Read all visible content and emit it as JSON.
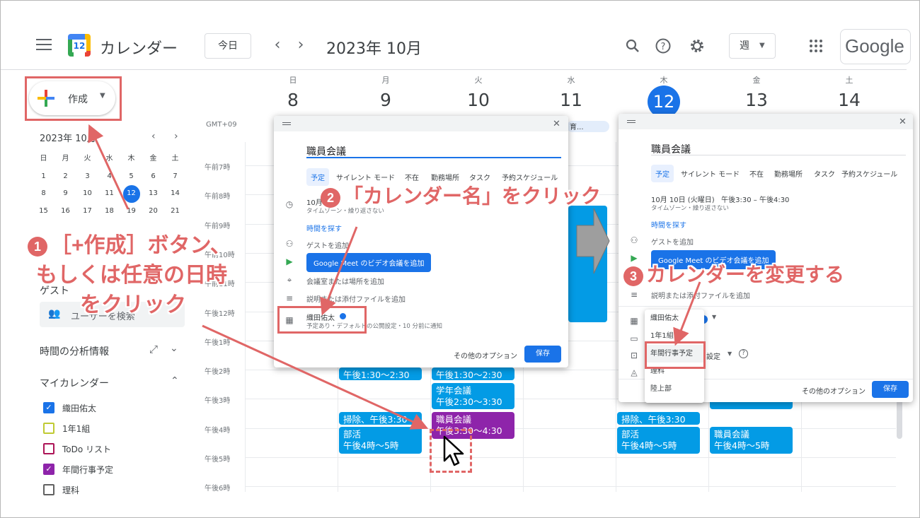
{
  "header": {
    "app_title": "カレンダー",
    "logo_day": "12",
    "today_label": "今日",
    "month_title": "2023年 10月",
    "view_label": "週",
    "google_logo": "Google"
  },
  "sidebar": {
    "create_label": "作成",
    "mini_cal": {
      "title": "2023年 10月",
      "weekdays": [
        "日",
        "月",
        "火",
        "水",
        "木",
        "金",
        "土"
      ],
      "days": [
        "1",
        "2",
        "3",
        "4",
        "5",
        "6",
        "7",
        "8",
        "9",
        "10",
        "11",
        "12",
        "13",
        "14",
        "15",
        "16",
        "17",
        "18",
        "19",
        "20",
        "21"
      ],
      "today": "12"
    },
    "guest_heading": "ゲスト",
    "guest_search_placeholder": "ユーザーを検索",
    "analytics_label": "時間の分析情報",
    "my_calendars_label": "マイカレンダー",
    "calendars": [
      {
        "name": "織田佑太",
        "color": "#1a73e8",
        "checked": true
      },
      {
        "name": "1年1組",
        "color": "#c0ca33",
        "checked": false
      },
      {
        "name": "ToDo リスト",
        "color": "#ad1457",
        "checked": false
      },
      {
        "name": "年間行事予定",
        "color": "#8e24aa",
        "checked": true
      },
      {
        "name": "理科",
        "color": "#616161",
        "checked": false
      }
    ]
  },
  "week": {
    "days": [
      {
        "name": "日",
        "num": "8"
      },
      {
        "name": "月",
        "num": "9"
      },
      {
        "name": "火",
        "num": "10"
      },
      {
        "name": "水",
        "num": "11"
      },
      {
        "name": "木",
        "num": "12"
      },
      {
        "name": "金",
        "num": "13"
      },
      {
        "name": "土",
        "num": "14"
      }
    ],
    "timezone": "GMT+09",
    "times": [
      "午前7時",
      "午前8時",
      "午前9時",
      "午前10時",
      "午前11時",
      "午後12時",
      "午後1時",
      "午後2時",
      "午後3時",
      "午後4時",
      "午後5時",
      "午後6時"
    ],
    "allday_event": "育...",
    "events": {
      "e1": "午後1:30～2:30",
      "e2": "午後1:30～2:30",
      "e3_title": "学年会議",
      "e3_time": "午後2:30～3:30",
      "e4": "掃除、午後3:30",
      "e5_title": "職員会議",
      "e5_time": "午後3:30～4:30",
      "e6_title": "部活",
      "e6_time": "午後4時～5時",
      "e7": "掃除、午後3:30",
      "e8_title": "部活",
      "e8_time": "午後4時～5時",
      "e9_title": "職員会議",
      "e9_time": "午後4時～5時"
    }
  },
  "dialog1": {
    "title_value": "職員会議",
    "tabs": [
      "予定",
      "サイレント モード",
      "不在",
      "勤務場所",
      "タスク",
      "予約スケジュール"
    ],
    "date_text": "10月",
    "tz_text": "タイムゾーン・繰り返さない",
    "find_time": "時間を探す",
    "add_guest": "ゲストを追加",
    "meet_btn": "Google Meet のビデオ会議を追加",
    "add_room": "会議室または場所を追加",
    "add_desc": "説明または添付ファイルを追加",
    "calendar_name": "織田佑太",
    "calendar_sub": "予定あり・デフォルトの公開設定・10 分前に通知",
    "more_options": "その他のオプション",
    "save": "保存"
  },
  "dialog2": {
    "title_value": "職員会議",
    "tabs": [
      "予定",
      "サイレント モード",
      "不在",
      "勤務場所",
      "タスク",
      "予約スケジュール"
    ],
    "date_text": "10月 10日 (火曜日)   午後3:30 – 午後4:30",
    "tz_text": "タイムゾーン・繰り返さない",
    "find_time": "時間を探す",
    "add_guest": "ゲストを追加",
    "meet_btn": "Google Meet のビデオ会議を追加",
    "add_desc": "説明または添付ファイルを追加",
    "visibility_partial": "設定",
    "more_options": "その他のオプション",
    "save": "保存",
    "dropdown": [
      "織田佑太",
      "1年1組",
      "年間行事予定",
      "理科",
      "陸上部"
    ]
  },
  "annotations": {
    "step1_num": "1",
    "step1_line1": "［+作成］ボタン、",
    "step1_line2": "もしくは任意の日時",
    "step1_line3": "をクリック",
    "step2_num": "2",
    "step2_text": "「カレンダー名」をクリック",
    "step3_num": "3",
    "step3_text": "カレンダーを変更する",
    "color": "#e06666"
  }
}
